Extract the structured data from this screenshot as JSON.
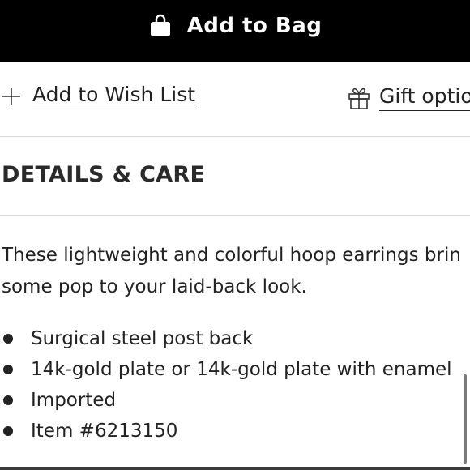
{
  "primary_action": {
    "label": "Add to Bag",
    "background": "#000000",
    "text_color": "#ffffff",
    "icon": "shopping-bag-icon"
  },
  "secondary_actions": {
    "wishlist": {
      "label": "Add to Wish List",
      "icon": "plus-icon"
    },
    "gift": {
      "label": "Gift optio",
      "icon": "gift-icon"
    }
  },
  "details": {
    "title": "DETAILS & CARE",
    "description_lines": [
      "These lightweight and colorful hoop earrings brin",
      "some pop to your laid-back look."
    ],
    "bullets": [
      "Surgical steel post back",
      "14k-gold plate or 14k-gold plate with enamel",
      "Imported",
      "Item #6213150"
    ]
  }
}
